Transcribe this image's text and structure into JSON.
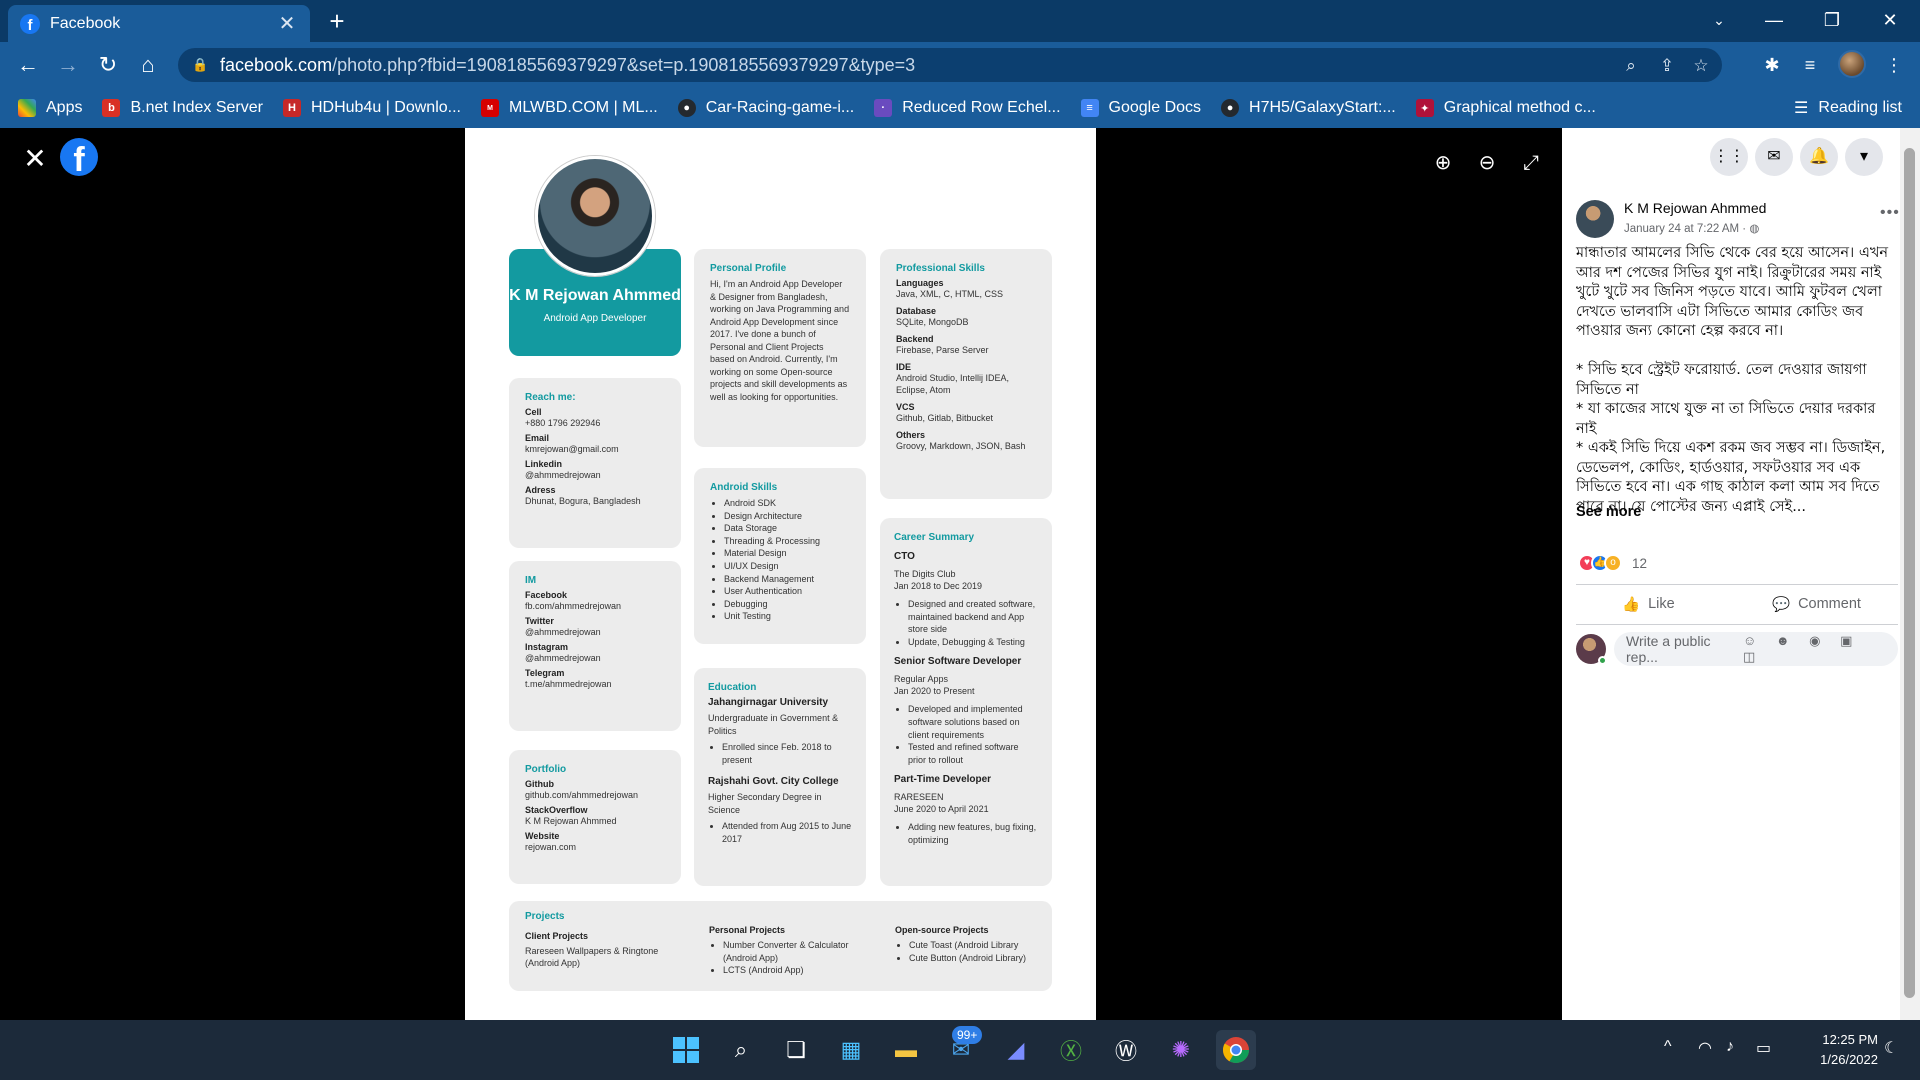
{
  "browser": {
    "tab_title": "Facebook",
    "url_prefix": "facebook.com",
    "url_rest": "/photo.php?fbid=1908185569379297&set=p.1908185569379297&type=3",
    "bookmarks": [
      {
        "label": "Apps",
        "color": "#e8453c"
      },
      {
        "label": "B.net Index Server",
        "color": "#d93025"
      },
      {
        "label": "HDHub4u | Downlo...",
        "color": "#c62828"
      },
      {
        "label": "MLWBD.COM | ML...",
        "color": "#d50000"
      },
      {
        "label": "Car-Racing-game-i...",
        "color": "#24292e"
      },
      {
        "label": "Reduced Row Echel...",
        "color": "#6a4bbf"
      },
      {
        "label": "Google Docs",
        "color": "#4285f4"
      },
      {
        "label": "H7H5/GalaxyStart:...",
        "color": "#24292e"
      },
      {
        "label": "Graphical method c...",
        "color": "#b0123a"
      }
    ],
    "reading_list": "Reading list"
  },
  "resume": {
    "name": "K M Rejowan Ahmmed",
    "role": "Android App Developer",
    "reach": {
      "title": "Reach me:",
      "items": [
        {
          "label": "Cell",
          "value": "+880 1796 292946"
        },
        {
          "label": "Email",
          "value": "kmrejowan@gmail.com"
        },
        {
          "label": "Linkedin",
          "value": "@ahmmedrejowan"
        },
        {
          "label": "Adress",
          "value": "Dhunat, Bogura, Bangladesh"
        }
      ]
    },
    "im": {
      "title": "IM",
      "items": [
        {
          "label": "Facebook",
          "value": "fb.com/ahmmedrejowan"
        },
        {
          "label": "Twitter",
          "value": "@ahmmedrejowan"
        },
        {
          "label": "Instagram",
          "value": "@ahmmedrejowan"
        },
        {
          "label": "Telegram",
          "value": "t.me/ahmmedrejowan"
        }
      ]
    },
    "portfolio": {
      "title": "Portfolio",
      "items": [
        {
          "label": "Github",
          "value": "github.com/ahmmedrejowan"
        },
        {
          "label": "StackOverflow",
          "value": "K M Rejowan Ahmmed"
        },
        {
          "label": "Website",
          "value": "rejowan.com"
        }
      ]
    },
    "profile": {
      "title": "Personal Profile",
      "text": "Hi, I'm an Android App Developer & Designer from Bangladesh, working on Java Programming and Android App Development since 2017. I've done a bunch of Personal and Client Projects based on Android. Currently, I'm working on some Open-source projects and skill developments as well as looking for opportunities."
    },
    "android_skills": {
      "title": "Android Skills",
      "items": [
        "Android SDK",
        "Design Architecture",
        "Data Storage",
        "Threading & Processing",
        "Material Design",
        "UI/UX Design",
        "Backend Management",
        "User Authentication",
        "Debugging",
        "Unit Testing"
      ]
    },
    "education": {
      "title": "Education",
      "entries": [
        {
          "school": "Jahangirnagar University",
          "degree": "Undergraduate in Government & Politics",
          "note": "Enrolled since Feb. 2018 to present"
        },
        {
          "school": "Rajshahi Govt. City College",
          "degree": "Higher Secondary Degree in Science",
          "note": "Attended from Aug 2015 to June 2017"
        }
      ]
    },
    "pro_skills": {
      "title": "Professional Skills",
      "items": [
        {
          "label": "Languages",
          "value": "Java, XML, C, HTML, CSS"
        },
        {
          "label": "Database",
          "value": "SQLite, MongoDB"
        },
        {
          "label": "Backend",
          "value": "Firebase, Parse Server"
        },
        {
          "label": "IDE",
          "value": "Android Studio, Intellij IDEA, Eclipse, Atom"
        },
        {
          "label": "VCS",
          "value": "Github, Gitlab, Bitbucket"
        },
        {
          "label": "Others",
          "value": "Groovy, Markdown, JSON, Bash"
        }
      ]
    },
    "career": {
      "title": "Career Summary",
      "jobs": [
        {
          "title": "CTO",
          "org": "The Digits Club",
          "period": "Jan 2018 to Dec 2019",
          "points": [
            "Designed and created software, maintained backend and App store side",
            "Update, Debugging & Testing"
          ]
        },
        {
          "title": "Senior Software Developer",
          "org": "Regular Apps",
          "period": "Jan 2020 to Present",
          "points": [
            "Developed and implemented software solutions based on client requirements",
            "Tested and refined software prior to rollout"
          ]
        },
        {
          "title": "Part-Time Developer",
          "org": "RARESEEN",
          "period": "June 2020 to April 2021",
          "points": [
            "Adding new features, bug fixing, optimizing"
          ]
        }
      ]
    },
    "projects": {
      "title": "Projects",
      "client_title": "Client Projects",
      "client_text": "Rareseen Wallpapers & Ringtone (Android App)",
      "personal_title": "Personal Projects",
      "personal_items": [
        "Number Converter & Calculator (Android App)",
        "LCTS (Android App)"
      ],
      "open_title": "Open-source Projects",
      "open_items": [
        "Cute Toast (Android Library",
        "Cute Button (Android Library)"
      ]
    }
  },
  "post": {
    "author": "K M Rejowan Ahmmed",
    "date": "January 24 at 7:22 AM ·",
    "body": "মান্ধাতার আমলের সিভি থেকে বের হয়ে আসেন। এখন আর দশ পেজের সিভির যুগ নাই। রিক্রুটারের সময় নাই খুটে খুটে সব জিনিস পড়তে যাবে। আমি ফুটবল খেলা দেখতে ভালবাসি এটা সিভিতে আমার কোডিং জব পাওয়ার জন্য কোনো হেল্প করবে না।\n\n* সিভি হবে স্ট্রেইট ফরোয়ার্ড. তেল দেওয়ার জায়গা সিভিতে না\n* যা কাজের সাথে যুক্ত না তা সিভিতে দেয়ার দরকার নাই\n* একই সিভি দিয়ে একশ রকম জব সম্ভব না। ডিজাইন, ডেভেলপ, কোডিং, হার্ডওয়ার, সফটওয়ার সব এক সিভিতে হবে না। এক গাছ কাঠাল কলা আম সব দিতে পারে না। যে পোস্টের জন্য এপ্লাই সেই...",
    "see_more": "See more",
    "reaction_count": "12",
    "like": "Like",
    "comment": "Comment",
    "comment_placeholder": "Write a public rep..."
  },
  "taskbar": {
    "badge": "99+",
    "time": "12:25 PM",
    "date": "1/26/2022"
  }
}
